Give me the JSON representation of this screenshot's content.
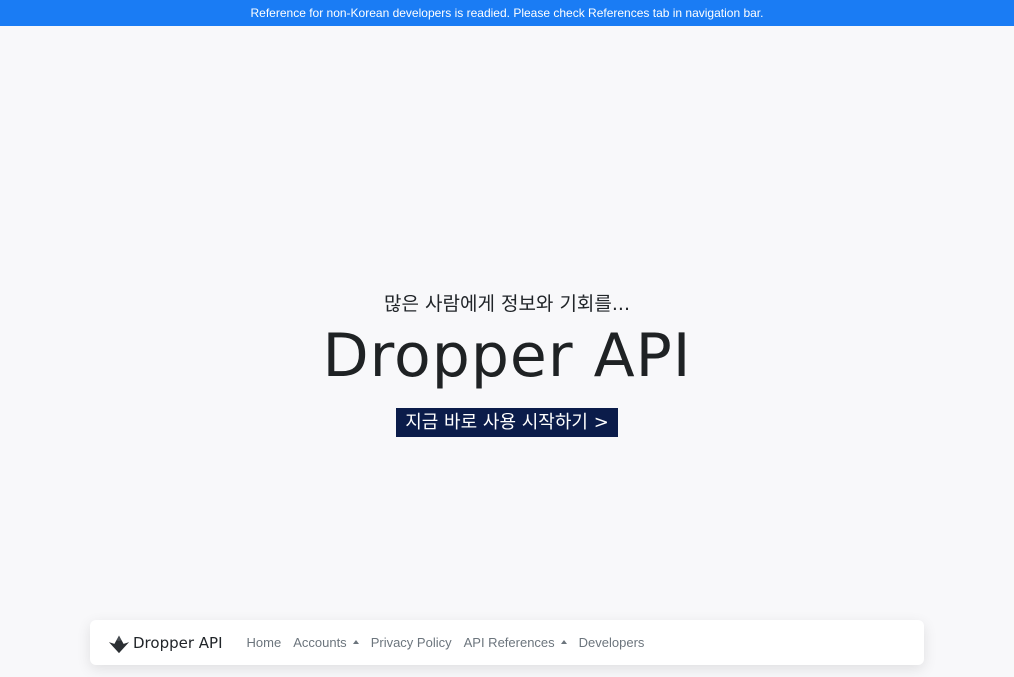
{
  "notice": {
    "text": "Reference for non-Korean developers is readied. Please check References tab in navigation bar."
  },
  "hero": {
    "subtitle": "많은 사람에게 정보와 기회를...",
    "title": "Dropper API",
    "cta_label": "지금 바로 사용 시작하기 >"
  },
  "navbar": {
    "brand": "Dropper API",
    "items": [
      {
        "label": "Home"
      },
      {
        "label": "Accounts"
      },
      {
        "label": "Privacy Policy"
      },
      {
        "label": "API References"
      },
      {
        "label": "Developers"
      }
    ]
  },
  "colors": {
    "notice_bg": "#1a7cf4",
    "cta_bg": "#0b1c4a",
    "page_bg": "#f8f8fa"
  }
}
